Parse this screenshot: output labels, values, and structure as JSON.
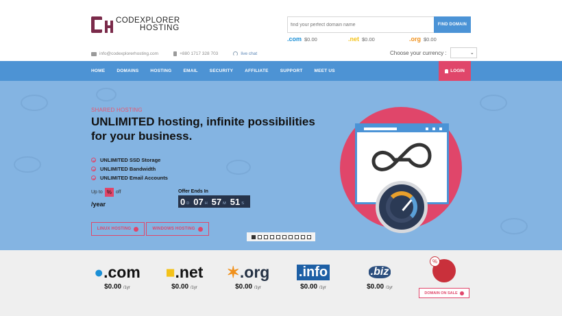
{
  "brand": {
    "line1": "CODEXPLORER",
    "line2": "HOSTING"
  },
  "search": {
    "placeholder": "find your perfect domain name",
    "button": "FIND DOMAIN"
  },
  "header_prices": [
    {
      "tld": ".com",
      "price": "$0.00"
    },
    {
      "tld": ".net",
      "price": "$0.00"
    },
    {
      "tld": ".org",
      "price": "$0.00"
    }
  ],
  "contact": {
    "email": "info@codexplorerhosting.com",
    "phone": "+880 1717 328 703",
    "chat": "live chat"
  },
  "currency": {
    "label": "Choose your currency :",
    "selected": ""
  },
  "nav": [
    "HOME",
    "DOMAINS",
    "HOSTING",
    "EMAIL",
    "SECURITY",
    "AFFILIATE",
    "SUPPORT",
    "MEET US"
  ],
  "login": "LOGIN",
  "hero": {
    "kicker": "SHARED HOSTING",
    "headline": "UNLIMITED hosting, infinite possibilities for your business.",
    "features": [
      "UNLIMITED SSD Storage",
      "UNLIMITED Bandwidth",
      "UNLIMITED Email Accounts"
    ],
    "price_prefix": "Up to",
    "price_badge": "%",
    "price_suffix": "off",
    "period": "/year",
    "offer_label": "Offer Ends In",
    "timer": {
      "days": "0",
      "d_unit": "D",
      "hours": "07",
      "h_unit": "H",
      "minutes": "57",
      "m_unit": "M",
      "seconds": "51",
      "s_unit": "S"
    },
    "cta_linux": "LINUX HOSTING",
    "cta_windows": "WINDOWS HOSTING",
    "slides": 10,
    "active_slide": 0
  },
  "domains": [
    {
      "tld": ".com",
      "price": "$0.00",
      "period": "/1yr"
    },
    {
      "tld": ".net",
      "price": "$0.00",
      "period": "/1yr"
    },
    {
      "tld": ".org",
      "price": "$0.00",
      "period": "/1yr"
    },
    {
      "tld": ".info",
      "price": "$0.00",
      "period": "/1yr"
    },
    {
      "tld": ".biz",
      "price": "$0.00",
      "period": "/1yr"
    }
  ],
  "sale": {
    "badge": "%",
    "button": "DOMAIN ON SALE"
  },
  "colors": {
    "accent": "#e0466a",
    "nav": "#4d93d4",
    "hero_bg": "#84b4e2",
    "brand": "#7a2a4a"
  }
}
